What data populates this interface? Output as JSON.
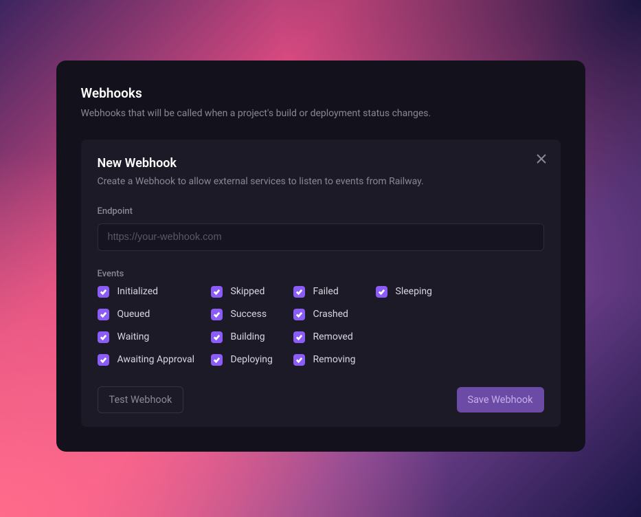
{
  "page": {
    "title": "Webhooks",
    "subtitle": "Webhooks that will be called when a project's build or deployment status changes."
  },
  "panel": {
    "title": "New Webhook",
    "subtitle": "Create a Webhook to allow external services to listen to events from Railway.",
    "endpoint_label": "Endpoint",
    "endpoint_placeholder": "https://your-webhook.com",
    "endpoint_value": "",
    "events_label": "Events",
    "events": [
      {
        "label": "Initialized",
        "checked": true
      },
      {
        "label": "Skipped",
        "checked": true
      },
      {
        "label": "Failed",
        "checked": true
      },
      {
        "label": "Sleeping",
        "checked": true
      },
      {
        "label": "Queued",
        "checked": true
      },
      {
        "label": "Success",
        "checked": true
      },
      {
        "label": "Crashed",
        "checked": true
      },
      {
        "label": "Waiting",
        "checked": true
      },
      {
        "label": "Building",
        "checked": true
      },
      {
        "label": "Removed",
        "checked": true
      },
      {
        "label": "Awaiting Approval",
        "checked": true
      },
      {
        "label": "Deploying",
        "checked": true
      },
      {
        "label": "Removing",
        "checked": true
      }
    ],
    "test_button": "Test Webhook",
    "save_button": "Save Webhook"
  }
}
